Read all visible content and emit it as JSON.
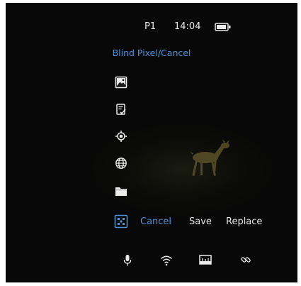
{
  "status_bar": {
    "preset": "P1",
    "time": "14:04",
    "battery_icon": "battery-icon"
  },
  "menu": {
    "title": "Blind Pixel/Cancel",
    "sidebar_icons": [
      "image-icon",
      "edit-document-icon",
      "crosshair-icon",
      "globe-icon",
      "folder-icon"
    ],
    "selected_icon": "blind-pixel-icon"
  },
  "actions": {
    "cancel": "Cancel",
    "save": "Save",
    "replace": "Replace"
  },
  "bottom_bar_icons": [
    "microphone-icon",
    "wifi-icon",
    "ruler-icon",
    "link-icon"
  ],
  "colors": {
    "accent": "#4a93d8",
    "text": "#e6e6e6",
    "background": "#080808"
  }
}
